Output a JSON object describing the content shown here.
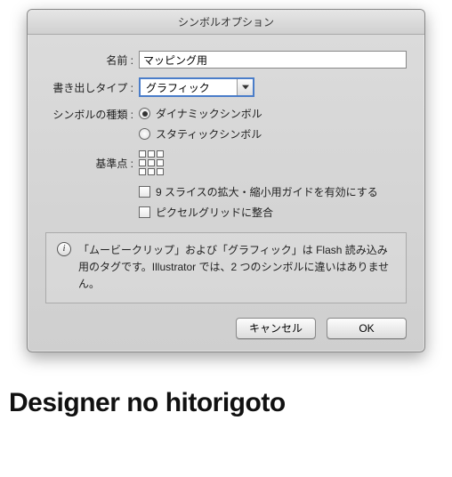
{
  "dialog": {
    "title": "シンボルオプション",
    "name_label": "名前",
    "name_value": "マッピング用",
    "export_type_label": "書き出しタイプ",
    "export_type_value": "グラフィック",
    "symbol_kind_label": "シンボルの種類",
    "radio_dynamic": "ダイナミックシンボル",
    "radio_static": "スタティックシンボル",
    "registration_label": "基準点",
    "checkbox_9slice": "9 スライスの拡大・縮小用ガイドを有効にする",
    "checkbox_pixelgrid": "ピクセルグリッドに整合",
    "info_text": "「ムービークリップ」および「グラフィック」は Flash 読み込み用のタグです。Illustrator では、2 つのシンボルに違いはありません。",
    "cancel": "キャンセル",
    "ok": "OK"
  },
  "footer": {
    "text": "Designer no hitorigoto"
  }
}
